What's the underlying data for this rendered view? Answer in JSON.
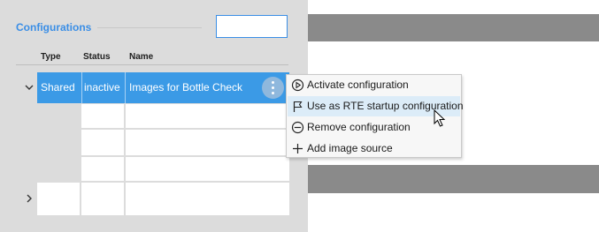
{
  "panel": {
    "title": "Configurations",
    "search_value": ""
  },
  "table": {
    "headers": {
      "type": "Type",
      "status": "Status",
      "name": "Name"
    },
    "selected_row": {
      "type": "Shared",
      "status": "inactive",
      "name": "Images for Bottle Check"
    },
    "expander_expanded": "⌄",
    "expander_collapsed": "›"
  },
  "context_menu": {
    "items": [
      {
        "label": "Activate configuration",
        "icon": "play-circle-icon"
      },
      {
        "label": "Use as RTE startup configuration",
        "icon": "flag-icon"
      },
      {
        "label": "Remove configuration",
        "icon": "minus-circle-icon"
      },
      {
        "label": "Add image source",
        "icon": "plus-icon"
      }
    ],
    "hovered_index": 1
  },
  "colors": {
    "accent": "#3a8ee6",
    "selected_row": "#3b9ae6",
    "menu_hover": "#dcecf8",
    "panel_bg": "#dcdcdc",
    "bar": "#8a8a8a"
  }
}
